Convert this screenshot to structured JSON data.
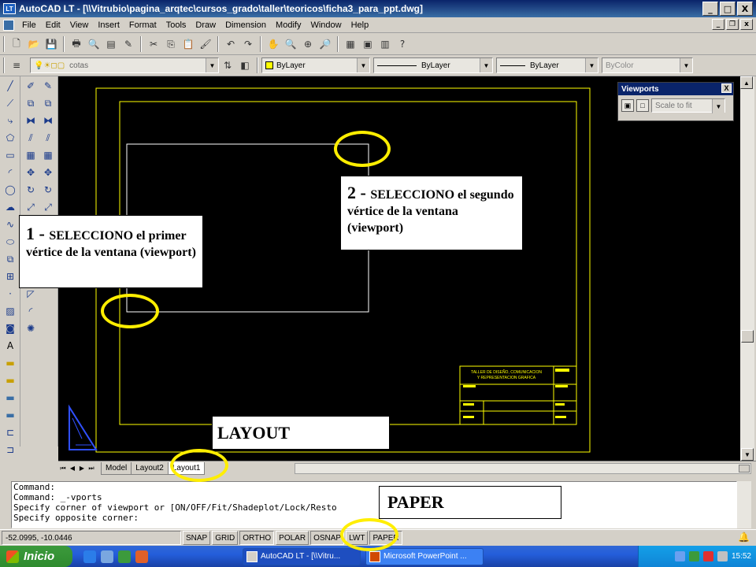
{
  "titlebar": {
    "title": "AutoCAD LT - [\\\\Vitrubio\\pagina_arqtec\\cursos_grado\\taller\\teoricos\\ficha3_para_ppt.dwg]",
    "app_badge": "LT",
    "minimize": "_",
    "maximize": "□",
    "close": "X"
  },
  "menubar": {
    "items": [
      "File",
      "Edit",
      "View",
      "Insert",
      "Format",
      "Tools",
      "Draw",
      "Dimension",
      "Modify",
      "Window",
      "Help"
    ],
    "mdi_minimize": "_",
    "mdi_restore": "❐",
    "mdi_close": "x"
  },
  "toolbar2": {
    "layer_name": "cotas",
    "color": "ByLayer",
    "linetype": "ByLayer",
    "lineweight": "ByLayer",
    "plotstyle": "ByColor",
    "swatch_color": "#ffff00"
  },
  "viewports_toolbar": {
    "title": "Viewports",
    "close": "X",
    "scale": "Scale to fit"
  },
  "tabs": {
    "items": [
      "Model",
      "Layout2",
      "Layout1"
    ],
    "active": "Layout1"
  },
  "command": {
    "lines": [
      "Command:",
      "Command: _-vports",
      "Specify corner of viewport or [ON/OFF/Fit/Shadeplot/Lock/Resto",
      "Specify opposite corner:"
    ]
  },
  "statusbar": {
    "coords": "-52.0995, -10.0446",
    "toggles": [
      {
        "label": "SNAP",
        "on": false
      },
      {
        "label": "GRID",
        "on": false
      },
      {
        "label": "ORTHO",
        "on": true
      },
      {
        "label": "POLAR",
        "on": false
      },
      {
        "label": "OSNAP",
        "on": true
      },
      {
        "label": "LWT",
        "on": false
      },
      {
        "label": "PAPER",
        "on": true
      }
    ]
  },
  "taskbar": {
    "start": "Inicio",
    "windows": [
      {
        "label": "AutoCAD LT - [\\\\Vitru...",
        "active": true
      },
      {
        "label": "Microsoft PowerPoint ...",
        "active": false
      }
    ],
    "clock": "15:52"
  },
  "titleblock": {
    "line1": "TALLER DE DISEÑO, COMUNICACION",
    "line2": "Y REPRESENTACION GRAFICA"
  },
  "callouts": {
    "c1_num": "1 - ",
    "c1_text": "SELECCIONO el primer vértice de la ventana (viewport)",
    "c2_num": "2 - ",
    "c2_text": "SELECCIONO el segundo vértice de la ventana (viewport)",
    "c3": "LAYOUT",
    "c4": "PAPER"
  },
  "colors": {
    "paper_border": "#ffff00",
    "viewport_rect": "#ffffff",
    "highlight": "#ffee00"
  }
}
